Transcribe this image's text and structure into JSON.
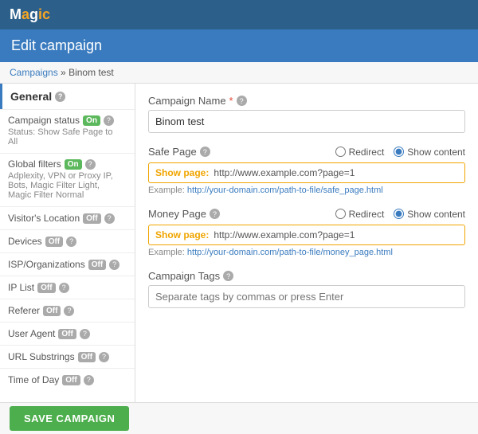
{
  "app": {
    "logo_text": "Magic",
    "logo_accent": "ic",
    "page_title": "Edit campaign"
  },
  "breadcrumb": {
    "link_text": "Campaigns",
    "separator": " » ",
    "current": "Binom test"
  },
  "sidebar": {
    "general_label": "General",
    "campaign_status_label": "Campaign status",
    "campaign_status_badge": "On",
    "campaign_status_sub": "Status: Show Safe Page to All",
    "global_filters_label": "Global filters",
    "global_filters_badge": "On",
    "global_filters_sub": "Adplexity, VPN or Proxy IP, Bots, Magic Filter Light, Magic Filter Normal",
    "items": [
      {
        "label": "Visitor's Location",
        "badge": "Off"
      },
      {
        "label": "Devices",
        "badge": "Off"
      },
      {
        "label": "ISP/Organizations",
        "badge": "Off"
      },
      {
        "label": "IP List",
        "badge": "Off"
      },
      {
        "label": "Referer",
        "badge": "Off"
      },
      {
        "label": "User Agent",
        "badge": "Off"
      },
      {
        "label": "URL Substrings",
        "badge": "Off"
      },
      {
        "label": "Time of Day",
        "badge": "Off"
      }
    ]
  },
  "form": {
    "campaign_name_label": "Campaign Name",
    "campaign_name_value": "Binom test",
    "safe_page_label": "Safe Page",
    "safe_page_redirect_label": "Redirect",
    "safe_page_show_label": "Show content",
    "safe_page_show_prefix": "Show page:",
    "safe_page_show_url": "http://www.example.com?page=1",
    "safe_page_example_prefix": "Example:",
    "safe_page_example_url": "http://your-domain.com/path-to-file/safe_page.html",
    "money_page_label": "Money Page",
    "money_page_redirect_label": "Redirect",
    "money_page_show_label": "Show content",
    "money_page_show_prefix": "Show page:",
    "money_page_show_url": "http://www.example.com?page=1",
    "money_page_example_prefix": "Example:",
    "money_page_example_url": "http://your-domain.com/path-to-file/money_page.html",
    "campaign_tags_label": "Campaign Tags",
    "campaign_tags_placeholder": "Separate tags by commas or press Enter"
  },
  "footer": {
    "save_button_label": "SAVE CAMPAIGN"
  }
}
